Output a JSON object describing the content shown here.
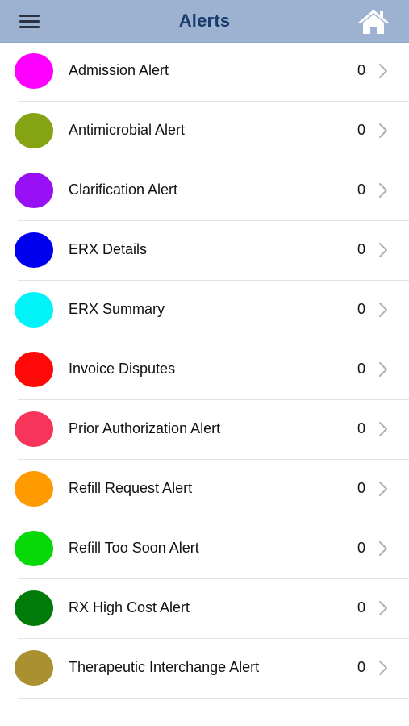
{
  "header": {
    "title": "Alerts"
  },
  "alerts": [
    {
      "label": "Admission Alert",
      "count": "0",
      "color": "#ff00ff"
    },
    {
      "label": "Antimicrobial Alert",
      "count": "0",
      "color": "#86a314"
    },
    {
      "label": "Clarification Alert",
      "count": "0",
      "color": "#9810f5"
    },
    {
      "label": "ERX Details",
      "count": "0",
      "color": "#0000ee"
    },
    {
      "label": "ERX Summary",
      "count": "0",
      "color": "#00f3f7"
    },
    {
      "label": "Invoice Disputes",
      "count": "0",
      "color": "#ff0808"
    },
    {
      "label": "Prior Authorization Alert",
      "count": "0",
      "color": "#f7355b"
    },
    {
      "label": "Refill Request Alert",
      "count": "0",
      "color": "#ff9b00"
    },
    {
      "label": "Refill Too Soon Alert",
      "count": "0",
      "color": "#07d807"
    },
    {
      "label": "RX High Cost Alert",
      "count": "0",
      "color": "#007a08"
    },
    {
      "label": "Therapeutic Interchange Alert",
      "count": "0",
      "color": "#a99130"
    }
  ],
  "icons": {
    "menu": "hamburger-menu-icon",
    "home": "home-icon",
    "row_indicator": "chevron-right-icon"
  }
}
